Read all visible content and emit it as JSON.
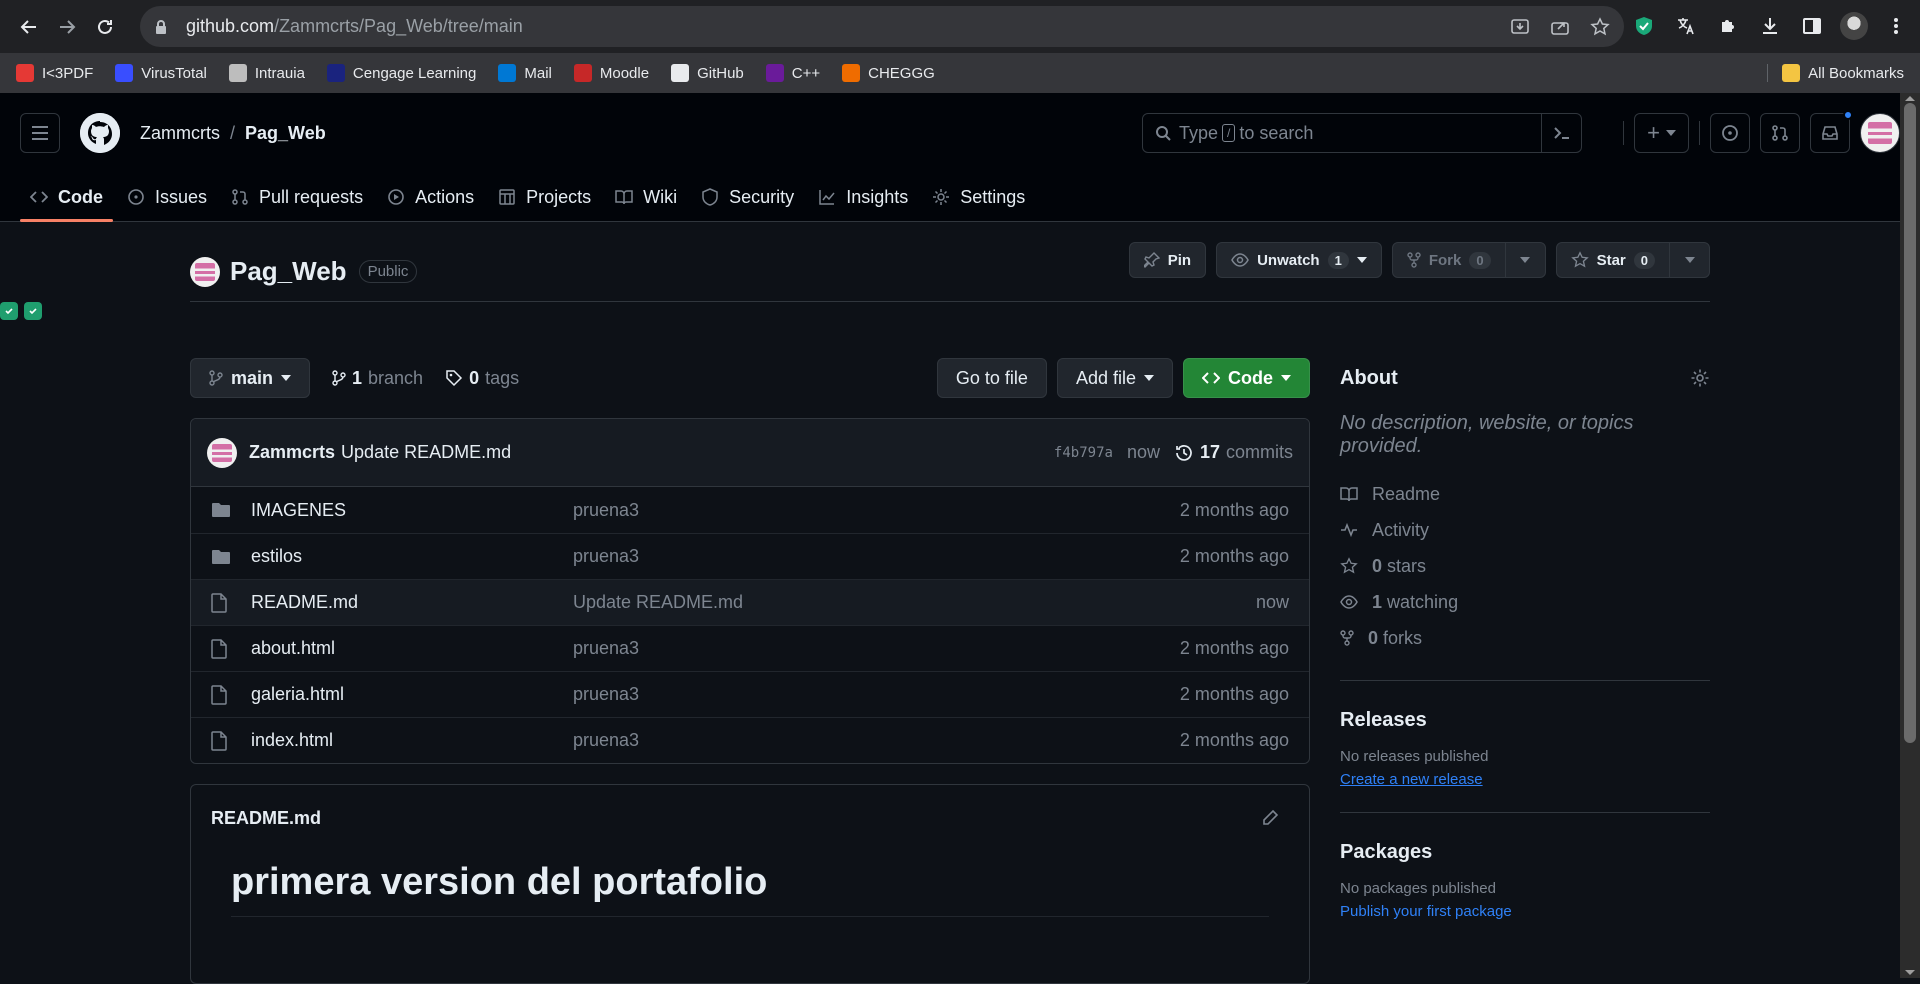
{
  "browser": {
    "url_host": "github.com",
    "url_path": "/Zammcrts/Pag_Web/tree/main",
    "bookmarks": [
      {
        "label": "I<3PDF",
        "color": "#e53935"
      },
      {
        "label": "VirusTotal",
        "color": "#394eff"
      },
      {
        "label": "Intrauia",
        "color": "#bdbdbd"
      },
      {
        "label": "Cengage Learning",
        "color": "#1a237e"
      },
      {
        "label": "Mail",
        "color": "#0078d4"
      },
      {
        "label": "Moodle",
        "color": "#c62828"
      },
      {
        "label": "GitHub",
        "color": "#e8eaed"
      },
      {
        "label": "C++",
        "color": "#6a1b9a"
      },
      {
        "label": "CHEGGG",
        "color": "#ef6c00"
      }
    ],
    "all_bookmarks": "All Bookmarks"
  },
  "header": {
    "owner": "Zammcrts",
    "separator": "/",
    "repo": "Pag_Web",
    "search_prefix": "Type",
    "search_key": "/",
    "search_suffix": "to search",
    "plus": "+"
  },
  "tabs": [
    {
      "label": "Code",
      "icon": "code-icon"
    },
    {
      "label": "Issues",
      "icon": "issue-icon"
    },
    {
      "label": "Pull requests",
      "icon": "pull-request-icon"
    },
    {
      "label": "Actions",
      "icon": "play-icon"
    },
    {
      "label": "Projects",
      "icon": "table-icon"
    },
    {
      "label": "Wiki",
      "icon": "book-icon"
    },
    {
      "label": "Security",
      "icon": "shield-icon"
    },
    {
      "label": "Insights",
      "icon": "graph-icon"
    },
    {
      "label": "Settings",
      "icon": "gear-icon"
    }
  ],
  "repo": {
    "name": "Pag_Web",
    "visibility": "Public",
    "pin": "Pin",
    "unwatch": "Unwatch",
    "watch_count": "1",
    "fork": "Fork",
    "fork_count": "0",
    "star": "Star",
    "star_count": "0"
  },
  "toolbar": {
    "branch": "main",
    "branch_count": "1",
    "branch_label": "branch",
    "tag_count": "0",
    "tag_label": "tags",
    "go_to_file": "Go to file",
    "add_file": "Add file",
    "code": "Code"
  },
  "commit": {
    "author": "Zammcrts",
    "message": "Update README.md",
    "sha": "f4b797a",
    "time": "now",
    "commit_count": "17",
    "commit_label": "commits"
  },
  "files": [
    {
      "name": "IMAGENES",
      "type": "folder",
      "message": "pruena3",
      "age": "2 months ago"
    },
    {
      "name": "estilos",
      "type": "folder",
      "message": "pruena3",
      "age": "2 months ago"
    },
    {
      "name": "README.md",
      "type": "file",
      "message": "Update README.md",
      "age": "now"
    },
    {
      "name": "about.html",
      "type": "file",
      "message": "pruena3",
      "age": "2 months ago"
    },
    {
      "name": "galeria.html",
      "type": "file",
      "message": "pruena3",
      "age": "2 months ago"
    },
    {
      "name": "index.html",
      "type": "file",
      "message": "pruena3",
      "age": "2 months ago"
    }
  ],
  "readme": {
    "title": "README.md",
    "heading": "primera version del portafolio"
  },
  "about": {
    "title": "About",
    "description": "No description, website, or topics provided.",
    "readme": "Readme",
    "activity": "Activity",
    "stars_count": "0",
    "stars_label": "stars",
    "watching_count": "1",
    "watching_label": "watching",
    "forks_count": "0",
    "forks_label": "forks"
  },
  "releases": {
    "title": "Releases",
    "none": "No releases published",
    "create": "Create a new release"
  },
  "packages": {
    "title": "Packages",
    "none": "No packages published",
    "publish": "Publish your first package"
  }
}
